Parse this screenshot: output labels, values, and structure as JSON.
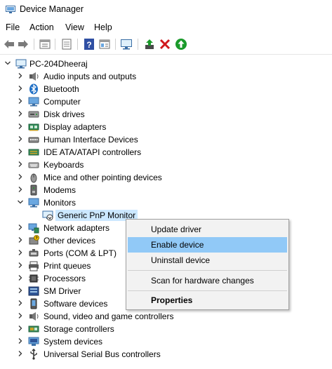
{
  "window": {
    "title": "Device Manager",
    "icon": "device-manager-icon"
  },
  "menu": [
    "File",
    "Action",
    "View",
    "Help"
  ],
  "toolbar": [
    "back-arrow-icon",
    "forward-arrow-icon",
    "properties-icon",
    "show-hidden-icon",
    "help-icon",
    "view-icon",
    "scan-hardware-icon",
    "update-driver-icon",
    "uninstall-device-icon",
    "enable-device-icon"
  ],
  "tree": {
    "root": "PC-204Dheeraj",
    "nodes": [
      {
        "label": "Audio inputs and outputs",
        "icon": "speaker-icon",
        "expanded": false
      },
      {
        "label": "Bluetooth",
        "icon": "bluetooth-icon",
        "expanded": false
      },
      {
        "label": "Computer",
        "icon": "computer-icon",
        "expanded": false
      },
      {
        "label": "Disk drives",
        "icon": "disk-drive-icon",
        "expanded": false
      },
      {
        "label": "Display adapters",
        "icon": "display-adapter-icon",
        "expanded": false
      },
      {
        "label": "Human Interface Devices",
        "icon": "hid-icon",
        "expanded": false
      },
      {
        "label": "IDE ATA/ATAPI controllers",
        "icon": "ide-controller-icon",
        "expanded": false
      },
      {
        "label": "Keyboards",
        "icon": "keyboard-icon",
        "expanded": false
      },
      {
        "label": "Mice and other pointing devices",
        "icon": "mouse-icon",
        "expanded": false
      },
      {
        "label": "Modems",
        "icon": "modem-icon",
        "expanded": false
      },
      {
        "label": "Monitors",
        "icon": "monitor-icon",
        "expanded": true
      },
      {
        "label": "Generic PnP Monitor",
        "icon": "monitor-disabled-icon",
        "child": true,
        "selected": true
      },
      {
        "label": "Network adapters",
        "icon": "network-adapter-icon",
        "expanded": false
      },
      {
        "label": "Other devices",
        "icon": "other-devices-icon",
        "expanded": false
      },
      {
        "label": "Ports (COM & LPT)",
        "icon": "port-icon",
        "expanded": false
      },
      {
        "label": "Print queues",
        "icon": "printer-icon",
        "expanded": false
      },
      {
        "label": "Processors",
        "icon": "processor-icon",
        "expanded": false
      },
      {
        "label": "SM Driver",
        "icon": "sm-driver-icon",
        "expanded": false
      },
      {
        "label": "Software devices",
        "icon": "software-device-icon",
        "expanded": false
      },
      {
        "label": "Sound, video and game controllers",
        "icon": "sound-controller-icon",
        "expanded": false
      },
      {
        "label": "Storage controllers",
        "icon": "storage-controller-icon",
        "expanded": false
      },
      {
        "label": "System devices",
        "icon": "system-device-icon",
        "expanded": false
      },
      {
        "label": "Universal Serial Bus controllers",
        "icon": "usb-icon",
        "expanded": false
      }
    ]
  },
  "context_menu": {
    "items": [
      {
        "label": "Update driver"
      },
      {
        "label": "Enable device",
        "highlighted": true
      },
      {
        "label": "Uninstall device"
      },
      {
        "separator": true
      },
      {
        "label": "Scan for hardware changes"
      },
      {
        "separator": true
      },
      {
        "label": "Properties",
        "bold": true
      }
    ]
  },
  "colors": {
    "highlight": "#91c9f7",
    "selection": "#cce8ff",
    "menu_bg": "#f2f2f2",
    "enable_green": "#1a9a2a",
    "uninstall_red": "#d0181c"
  }
}
